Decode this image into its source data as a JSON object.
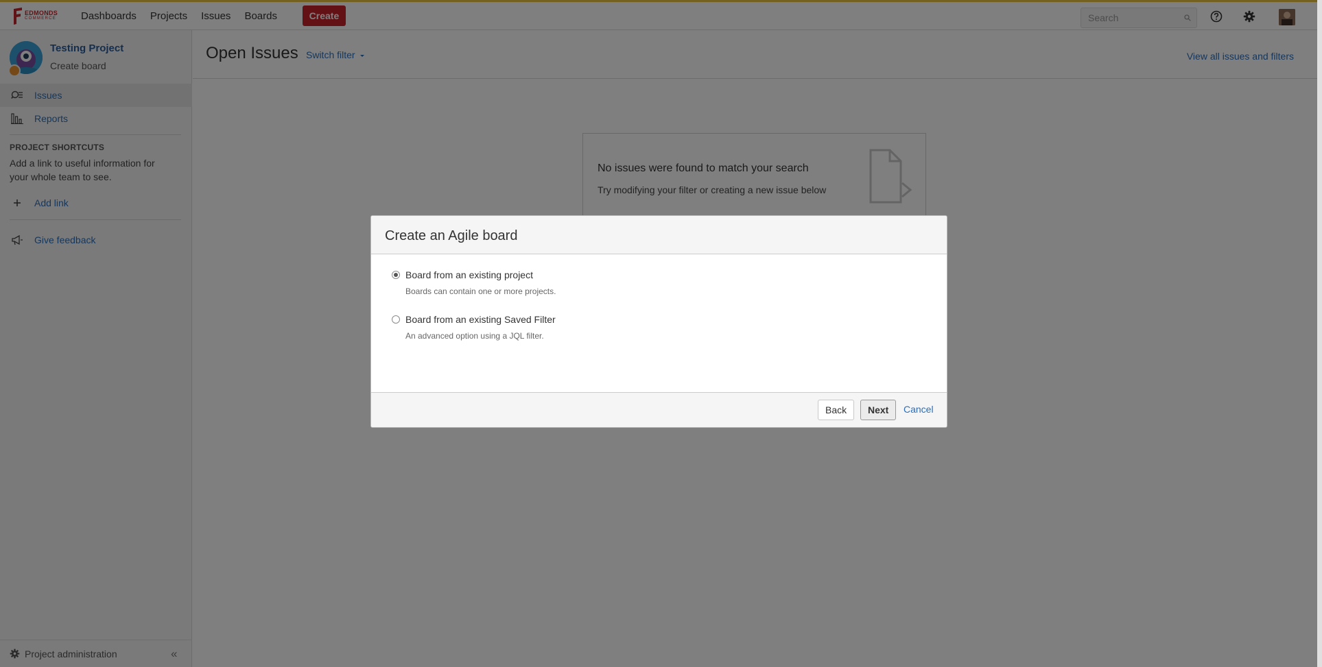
{
  "topnav": {
    "logo_text": "EDMONDS",
    "logo_sub": "COMMERCE",
    "items": [
      "Dashboards",
      "Projects",
      "Issues",
      "Boards"
    ],
    "create_label": "Create",
    "search_placeholder": "Search",
    "icons": [
      "help-icon",
      "gear-icon",
      "user-avatar"
    ]
  },
  "sidebar": {
    "project_name": "Testing Project",
    "project_sub": "Create board",
    "items": [
      {
        "label": "Issues",
        "icon": "issues-search-icon",
        "active": true
      },
      {
        "label": "Reports",
        "icon": "bar-chart-icon",
        "active": false
      }
    ],
    "shortcuts_title": "PROJECT SHORTCUTS",
    "shortcuts_desc": "Add a link to useful information for your whole team to see.",
    "add_link": "Add link",
    "feedback": "Give feedback",
    "admin": "Project administration",
    "collapse": "«"
  },
  "main": {
    "title": "Open Issues",
    "switch_filter": "Switch filter",
    "view_all": "View all issues and filters",
    "empty_title": "No issues were found to match your search",
    "empty_desc": "Try modifying your filter or creating a new issue below"
  },
  "dialog": {
    "title": "Create an Agile board",
    "options": [
      {
        "label": "Board from an existing project",
        "desc": "Boards can contain one or more projects.",
        "checked": true
      },
      {
        "label": "Board from an existing Saved Filter",
        "desc": "An advanced option using a JQL filter.",
        "checked": false
      }
    ],
    "back": "Back",
    "next": "Next",
    "cancel": "Cancel"
  },
  "colors": {
    "brand_red": "#c9222b",
    "link_blue": "#2a6ebb",
    "accent_top_border": "#e8c33f"
  }
}
